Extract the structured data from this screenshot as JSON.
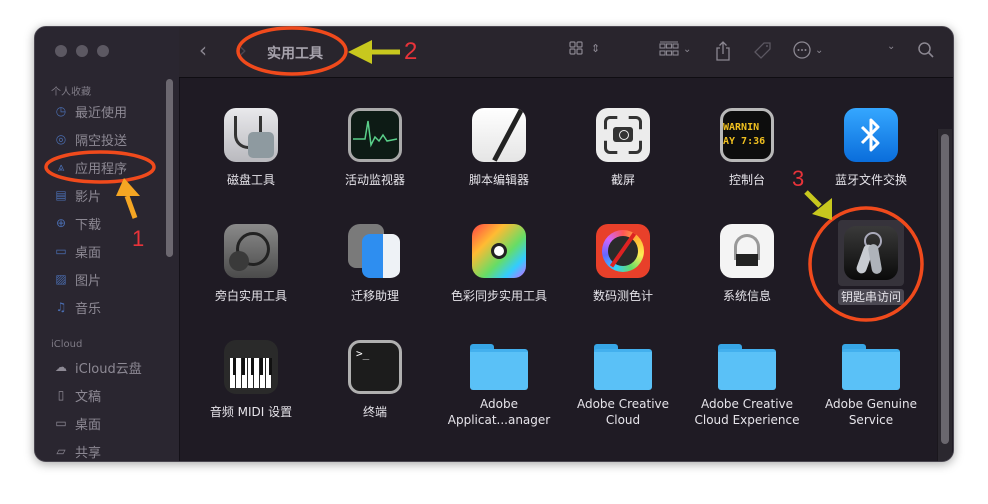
{
  "window": {
    "title": "实用工具",
    "toolbar": {
      "back_icon": "chevron-left-icon",
      "forward_icon": "chevron-right-icon",
      "view_icon": "grid-view-icon",
      "group_icon": "group-by-icon",
      "share_icon": "share-icon",
      "tag_icon": "tag-icon",
      "more_icon": "ellipsis-circle-icon",
      "search_icon": "search-icon"
    }
  },
  "sidebar": {
    "favorites_title": "个人收藏",
    "favorites": [
      {
        "label": "最近使用",
        "icon": "clock-icon"
      },
      {
        "label": "隔空投送",
        "icon": "airdrop-icon"
      },
      {
        "label": "应用程序",
        "icon": "applications-icon"
      },
      {
        "label": "影片",
        "icon": "film-icon"
      },
      {
        "label": "下载",
        "icon": "download-icon"
      },
      {
        "label": "桌面",
        "icon": "desktop-icon"
      },
      {
        "label": "图片",
        "icon": "photo-icon"
      },
      {
        "label": "音乐",
        "icon": "music-icon"
      }
    ],
    "icloud_title": "iCloud",
    "icloud": [
      {
        "label": "iCloud云盘",
        "icon": "cloud-icon"
      },
      {
        "label": "文稿",
        "icon": "document-icon"
      },
      {
        "label": "桌面",
        "icon": "desktop-icon"
      },
      {
        "label": "共享",
        "icon": "shared-folder-icon"
      }
    ]
  },
  "items": [
    {
      "label": "磁盘工具",
      "icon": "disk-utility-icon"
    },
    {
      "label": "活动监视器",
      "icon": "activity-monitor-icon"
    },
    {
      "label": "脚本编辑器",
      "icon": "script-editor-icon"
    },
    {
      "label": "截屏",
      "icon": "screenshot-icon"
    },
    {
      "label": "控制台",
      "icon": "console-icon",
      "icon_text1": "WARNIN",
      "icon_text2": "AY 7:36"
    },
    {
      "label": "蓝牙文件交换",
      "icon": "bluetooth-icon"
    },
    {
      "label": "旁白实用工具",
      "icon": "voiceover-icon"
    },
    {
      "label": "迁移助理",
      "icon": "migration-assistant-icon"
    },
    {
      "label": "色彩同步实用工具",
      "icon": "colorsync-icon"
    },
    {
      "label": "数码测色计",
      "icon": "digital-color-meter-icon"
    },
    {
      "label": "系统信息",
      "icon": "system-information-icon"
    },
    {
      "label": "钥匙串访问",
      "icon": "keychain-icon",
      "selected": true
    },
    {
      "label": "音频 MIDI 设置",
      "icon": "midi-icon"
    },
    {
      "label": "终端",
      "icon": "terminal-icon",
      "icon_text": ">_"
    },
    {
      "label": "Adobe Applicat...anager",
      "icon": "folder-icon"
    },
    {
      "label": "Adobe Creative Cloud",
      "icon": "folder-icon"
    },
    {
      "label": "Adobe Creative Cloud Experience",
      "icon": "folder-icon"
    },
    {
      "label": "Adobe Genuine Service",
      "icon": "folder-icon"
    }
  ],
  "annotations": {
    "step1": "1",
    "step2": "2",
    "step3": "3",
    "circle_color": "#f04a1c",
    "arrow1_color": "#f5a623",
    "arrow_yellow_color": "#c8c81e",
    "number_color": "#e8333a"
  }
}
